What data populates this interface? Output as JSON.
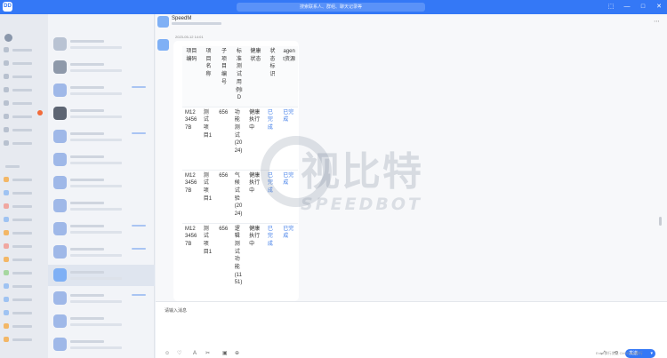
{
  "titlebar": {
    "logo": "DD",
    "search_placeholder": "搜索联系人、群组、聊天记录等",
    "controls": {
      "pin": "⬚",
      "minimize": "—",
      "maximize": "□",
      "close": "✕"
    }
  },
  "chat": {
    "name": "SpeedM",
    "menu": "⋯",
    "message_time": "2023-05-12 14:01",
    "table": {
      "headers": [
        "项目编码",
        "项目名称",
        "子项目编号",
        "标准测试用例ID",
        "健康状态",
        "状态标识",
        "agent资源"
      ],
      "rows": [
        [
          "M1234567B",
          "测试项目1",
          "656",
          "功能测试(2024)",
          "健康执行中",
          "已完成",
          "已完成"
        ],
        [
          "M1234567B",
          "测试项目1",
          "656",
          "气候试验(2024)",
          "健康执行中",
          "已完成",
          "已完成"
        ],
        [
          "M1234567B",
          "测试项目1",
          "656",
          "逻辑测试功能(1151)",
          "健康执行中",
          "已完成",
          "已完成"
        ]
      ]
    }
  },
  "composer": {
    "placeholder": "请输入消息",
    "send_label": "发送",
    "send_dropdown": "▾",
    "hint": "Enter换行发送  Ctrl+Enter换行",
    "tools": {
      "emoji": "☺",
      "like": "♡",
      "font": "A",
      "scissors": "✂",
      "image": "▣",
      "file": "⊕",
      "expand": "⤢",
      "history": "⟲"
    }
  },
  "watermark": {
    "cn": "视比特",
    "en": "SPEEDBOT"
  },
  "colors": {
    "accent": "#3478f6",
    "badge": "#f26b3a",
    "link": "#3d7be8"
  }
}
